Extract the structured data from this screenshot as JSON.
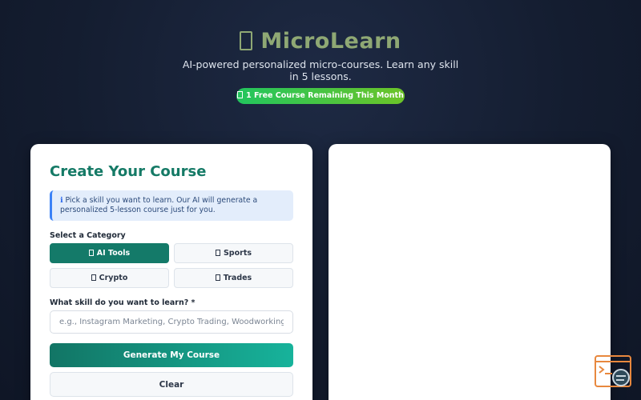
{
  "header": {
    "icon": "book-icon",
    "app_name": "MicroLearn",
    "tagline": "AI-powered personalized micro-courses. Learn any skill in 5 lessons.",
    "badge_icon": "gift-icon",
    "badge_text": "1 Free Course Remaining This Month"
  },
  "form": {
    "title": "Create Your Course",
    "info_icon": "info-icon",
    "info_prefix": "ℹ",
    "info_text": "Pick a skill you want to learn. Our AI will generate a personalized 5-lesson course just for you.",
    "category_label": "Select a Category",
    "categories": [
      {
        "label": "AI Tools",
        "icon": "robot-icon",
        "active": true
      },
      {
        "label": "Sports",
        "icon": "ball-icon",
        "active": false
      },
      {
        "label": "Crypto",
        "icon": "coin-icon",
        "active": false
      },
      {
        "label": "Trades",
        "icon": "hammer-icon",
        "active": false
      }
    ],
    "skill_label": "What skill do you want to learn? *",
    "skill_value": "",
    "skill_placeholder": "e.g., Instagram Marketing, Crypto Trading, Woodworking...",
    "generate_label": "Generate My Course",
    "clear_label": "Clear"
  },
  "colors": {
    "accent": "#147a69",
    "title": "#157a66",
    "badge_start": "#22c55e",
    "badge_end": "#6cc428",
    "logo": "#8fa874"
  }
}
